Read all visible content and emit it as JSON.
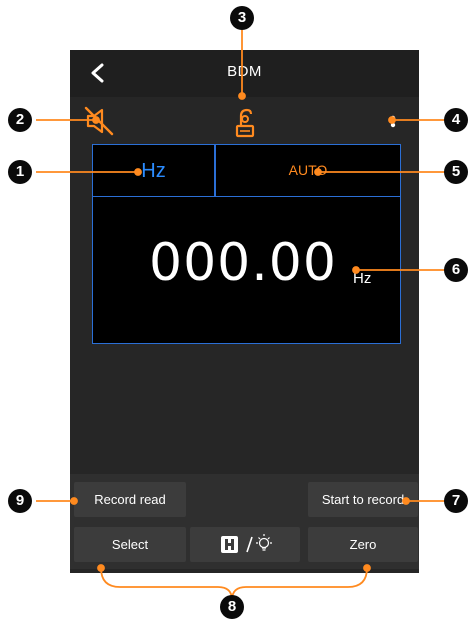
{
  "app": {
    "title": "BDM"
  },
  "display": {
    "unit": "Hz",
    "range": "AUTO",
    "reading": "000.00",
    "reading_unit": "Hz"
  },
  "buttons": {
    "record_read": "Record read",
    "start_record": "Start to record",
    "select": "Select",
    "zero": "Zero"
  },
  "callouts": {
    "c1": "1",
    "c2": "2",
    "c3": "3",
    "c4": "4",
    "c5": "5",
    "c6": "6",
    "c7": "7",
    "c8": "8",
    "c9": "9"
  },
  "colors": {
    "accent_orange": "#ff8a1f",
    "accent_blue": "#2b6fd6",
    "unit_blue": "#2b8cff"
  },
  "icons": {
    "back": "chevron-left-icon",
    "mute": "speaker-muted-icon",
    "probe": "probe-icon",
    "more": "more-vertical-icon",
    "hold": "hold-icon",
    "light": "lightbulb-icon"
  }
}
